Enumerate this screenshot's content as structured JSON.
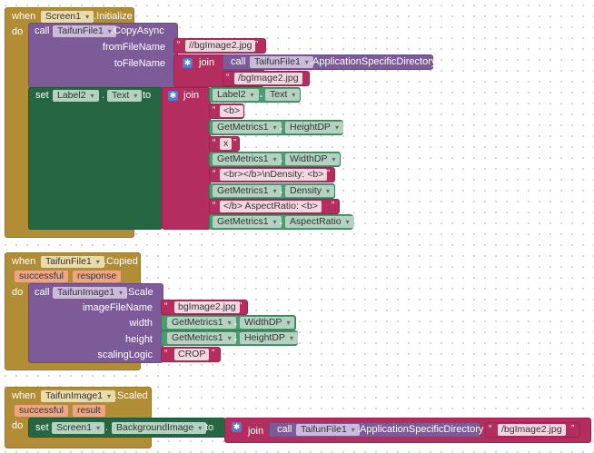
{
  "event1": {
    "when": "when",
    "component": "Screen1",
    "event": ".Initialize",
    "do": "do",
    "call": "call",
    "call_component": "TaifunFile1",
    "call_method": ".CopyAsync",
    "from_param": "fromFileName",
    "from_value": "//bgImage2.jpg",
    "to_param": "toFileName",
    "join": "join",
    "inner_call": "call",
    "inner_component": "TaifunFile1",
    "inner_prop": ".ApplicationSpecificDirectory",
    "to_value": "/bgImage2.jpg",
    "set": "set",
    "set_component": "Label2",
    "set_prop": "Text",
    "to": "to",
    "join2": "join",
    "items": {
      "i0_comp": "Label2",
      "i0_prop": "Text",
      "i1": "<b>",
      "i2_comp": "GetMetrics1",
      "i2_prop": "HeightDP",
      "i3": "x",
      "i4_comp": "GetMetrics1",
      "i4_prop": "WidthDP",
      "i5": "<br></b>\\nDensity: <b>",
      "i6_comp": "GetMetrics1",
      "i6_prop": "Density",
      "i7": "</b>    AspectRatio: <b>",
      "i8_comp": "GetMetrics1",
      "i8_prop": "AspectRatio"
    },
    "dot": "."
  },
  "event2": {
    "when": "when",
    "component": "TaifunFile1",
    "event": ".Copied",
    "param1": "successful",
    "param2": "response",
    "do": "do",
    "call": "call",
    "call_component": "TaifunImage1",
    "call_method": ".Scale",
    "p1": "imageFileName",
    "p1_value": "bgImage2.jpg",
    "p2": "width",
    "p2_comp": "GetMetrics1",
    "p2_prop": "WidthDP",
    "p3": "height",
    "p3_comp": "GetMetrics1",
    "p3_prop": "HeightDP",
    "p4": "scalingLogic",
    "p4_value": "CROP"
  },
  "event3": {
    "when": "when",
    "component": "TaifunImage1",
    "event": ".Scaled",
    "param1": "successful",
    "param2": "result",
    "do": "do",
    "set": "set",
    "set_component": "Screen1",
    "set_prop": "BackgroundImage",
    "to": "to",
    "join": "join",
    "call": "call",
    "call_component": "TaifunFile1",
    "call_prop": ".ApplicationSpecificDirectory",
    "value": "/bgImage2.jpg"
  },
  "icons": {
    "gear": "gear-icon",
    "quote": "quote-icon"
  },
  "colors": {
    "event": "#b18e35",
    "procedure": "#7d5b99",
    "setter": "#266643",
    "text": "#b32d5e",
    "getter": "#4b9c6e"
  }
}
